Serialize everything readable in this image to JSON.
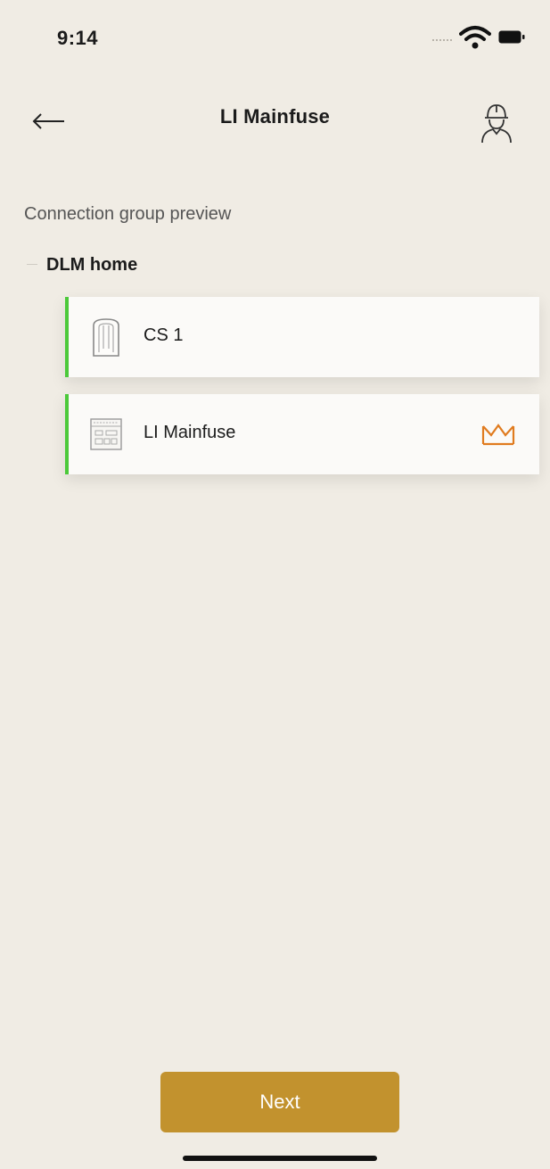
{
  "status_bar": {
    "time": "9:14",
    "icons": [
      "cellular-signal-icon",
      "wifi-icon",
      "battery-icon"
    ]
  },
  "nav": {
    "title": "LI Mainfuse",
    "back_icon": "back-arrow-icon",
    "profile_icon": "technician-icon"
  },
  "section": {
    "label": "Connection group preview"
  },
  "group": {
    "name": "DLM home",
    "items": [
      {
        "label": "CS 1",
        "icon": "charging-station-icon",
        "is_master": false
      },
      {
        "label": "LI Mainfuse",
        "icon": "load-controller-icon",
        "is_master": true
      }
    ]
  },
  "actions": {
    "next_label": "Next"
  },
  "colors": {
    "background": "#f0ece4",
    "accent": "#c2922e",
    "status_green": "#4cc93a",
    "crown": "#e07b1f"
  }
}
